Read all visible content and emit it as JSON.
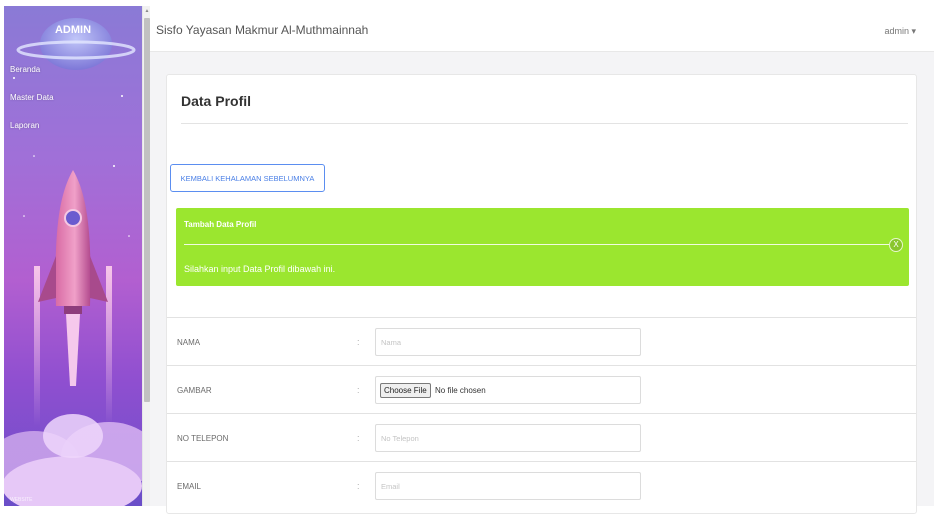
{
  "sidebar": {
    "logo": "ADMIN",
    "items": [
      {
        "label": "Beranda"
      },
      {
        "label": "Master Data"
      },
      {
        "label": "Laporan"
      }
    ],
    "footer": "WEBSITE"
  },
  "header": {
    "title": "Sisfo Yayasan Makmur Al-Muthmainnah",
    "user_menu": "admin ▾"
  },
  "page": {
    "title": "Data Profil",
    "back_button": "KEMBALI KEHALAMAN SEBELUMNYA",
    "alert": {
      "title": "Tambah Data Profil",
      "close": "X",
      "message": "Silahkan input Data Profil dibawah ini."
    }
  },
  "form": {
    "colon": ":",
    "fields": [
      {
        "label": "NAMA",
        "value": "",
        "placeholder": "Nama"
      },
      {
        "label": "GAMBAR",
        "file_button": "Choose File",
        "file_status": "No file chosen"
      },
      {
        "label": "NO TELEPON",
        "value": "",
        "placeholder": "No Telepon"
      },
      {
        "label": "EMAIL",
        "value": "",
        "placeholder": "Email"
      }
    ]
  },
  "colors": {
    "accent_blue": "#5b8ef0",
    "alert_green": "#9be62f",
    "sidebar_purple": "#a070d8"
  },
  "icons": [
    "rocket-illustration",
    "planet-illustration",
    "cloud-illustration",
    "close-icon",
    "caret-down-icon"
  ]
}
